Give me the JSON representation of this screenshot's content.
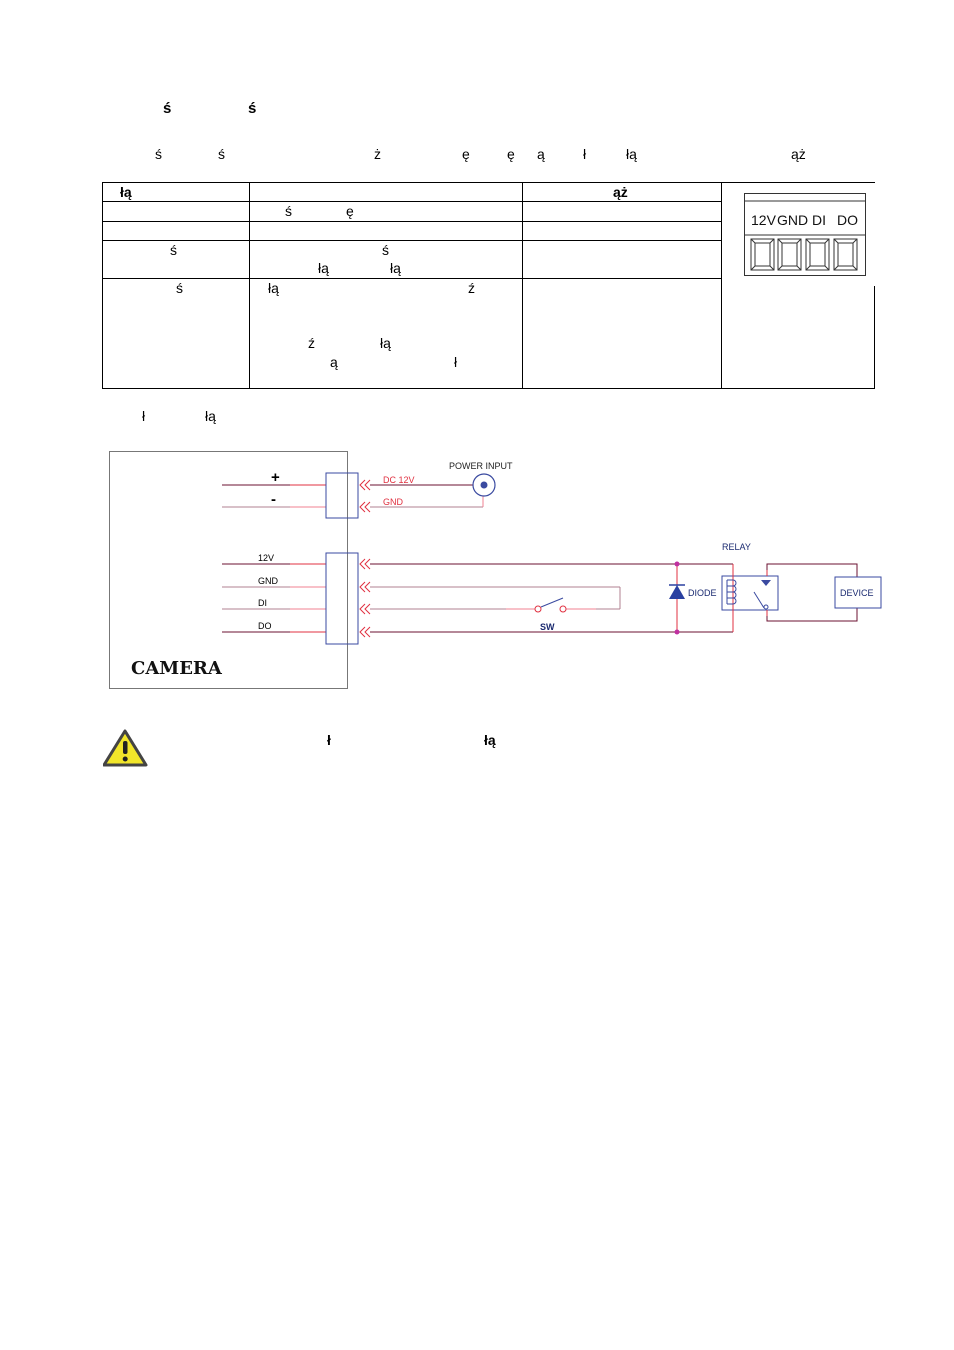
{
  "heading": {
    "glyphs": [
      "ś",
      "ś"
    ]
  },
  "intro": {
    "glyphs": [
      "ś",
      "ś",
      "ż",
      "ę",
      "ę",
      "ą",
      "ł",
      "łą",
      "ąż"
    ]
  },
  "table": {
    "header": {
      "col1": "łą",
      "col2": "",
      "col3": "ąż"
    },
    "rows": [
      {
        "col1": "",
        "col2": [
          "ś",
          "ę"
        ],
        "col3": ""
      },
      {
        "col1": "",
        "col2": [],
        "col3": ""
      },
      {
        "col1": "ś",
        "col2": [
          "ś",
          "łą",
          "łą"
        ],
        "col3": ""
      },
      {
        "col1": "ś",
        "col2": [
          "łą",
          "ź",
          "ź",
          "łą",
          "ą",
          "ł"
        ],
        "col3": ""
      }
    ],
    "terminal_block": {
      "labels": [
        "12V",
        "GND",
        "DI",
        "DO"
      ]
    }
  },
  "caption": {
    "glyphs": [
      "ł",
      "łą"
    ]
  },
  "diagram": {
    "camera_label": "CAMERA",
    "power_terminals": [
      "+",
      "-"
    ],
    "power_wires": [
      "DC 12V",
      "GND"
    ],
    "power_input_label": "POWER INPUT",
    "io_terminals": [
      "12V",
      "GND",
      "DI",
      "DO"
    ],
    "switch_label": "SW",
    "diode_label": "DIODE",
    "relay_label": "RELAY",
    "device_label": "DEVICE",
    "colors": {
      "wire_dark": "#6b1030",
      "wire_light": "#b08090",
      "wire_red": "#e03040",
      "box_blue": "#3a4aa0",
      "node": "#c030a0",
      "diode": "#2a40a0"
    }
  },
  "warning": {
    "icon": "warning-triangle-icon",
    "glyphs": [
      "ł",
      "łą"
    ]
  }
}
